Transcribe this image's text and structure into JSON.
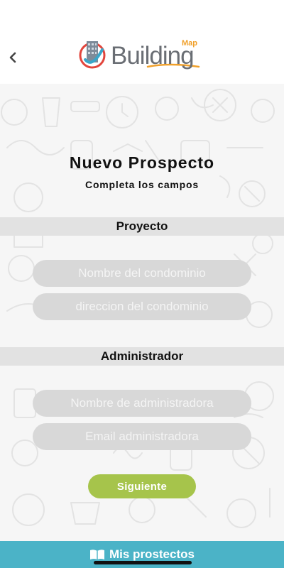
{
  "header": {
    "back_icon": "chevron-left-icon",
    "logo_word": "Building",
    "logo_map": "Map"
  },
  "page": {
    "title": "Nuevo Prospecto",
    "subtitle": "Completa los campos"
  },
  "sections": {
    "project": {
      "label": "Proyecto",
      "fields": [
        {
          "placeholder": "Nombre del condominio",
          "value": ""
        },
        {
          "placeholder": "direccion del condominio",
          "value": ""
        }
      ]
    },
    "admin": {
      "label": "Administrador",
      "fields": [
        {
          "placeholder": "Nombre de administradora",
          "value": ""
        },
        {
          "placeholder": "Email administradora",
          "value": ""
        }
      ]
    }
  },
  "actions": {
    "next_label": "Siguiente"
  },
  "bottom_bar": {
    "icon": "book-open-icon",
    "label": "Mis prostectos"
  },
  "colors": {
    "accent_green": "#a6c44b",
    "bottom_bar": "#4bb3c7",
    "logo_orange": "#f0a02a",
    "logo_gray": "#6a6e74"
  }
}
